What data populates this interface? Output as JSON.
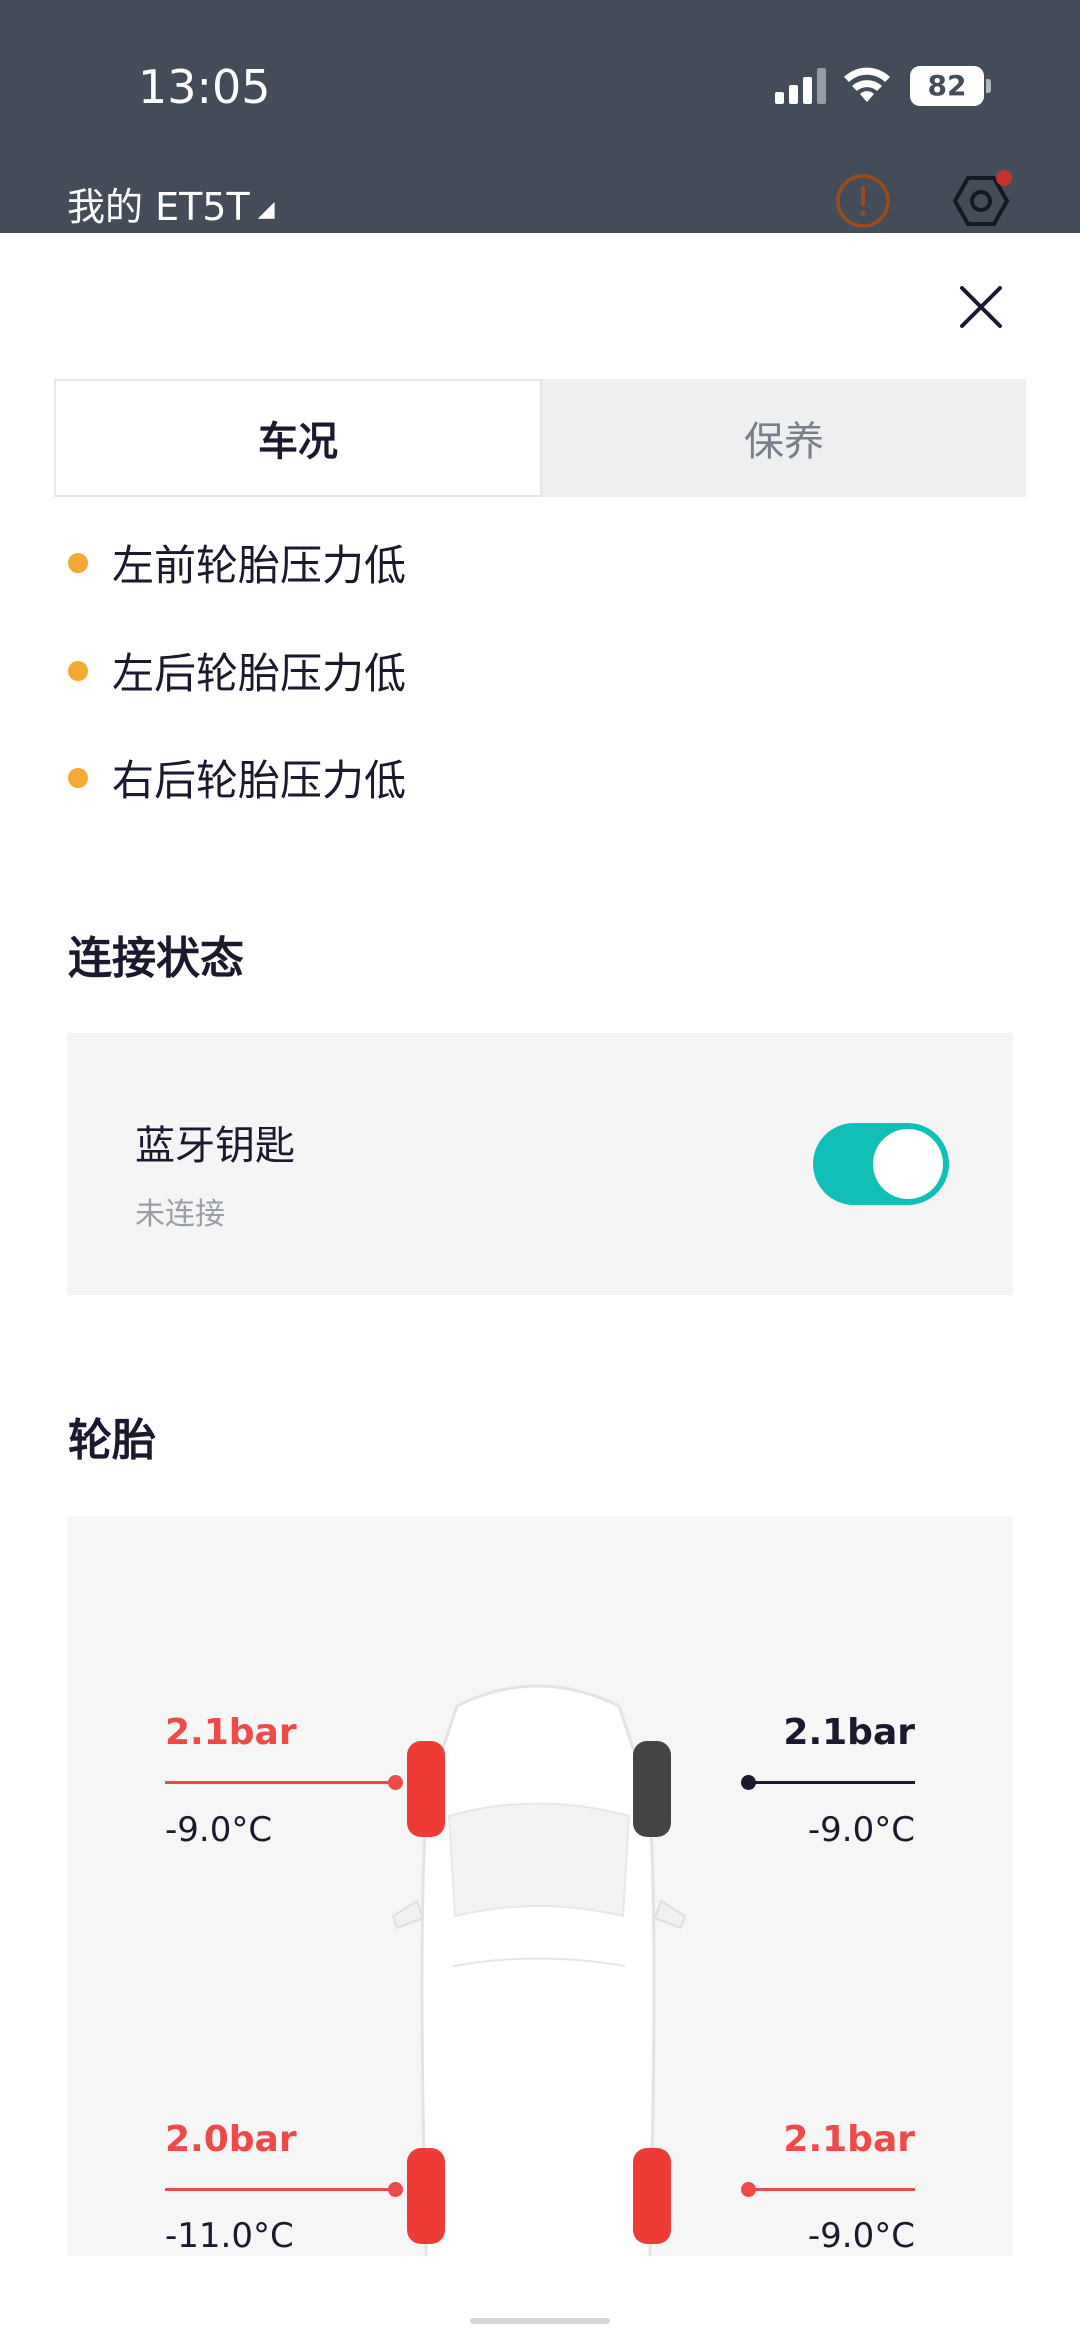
{
  "status_bar": {
    "time": "13:05",
    "battery": "82",
    "signal_icon": "cellular-signal-icon",
    "wifi_icon": "wifi-icon"
  },
  "header": {
    "car_name": "我的 ET5T",
    "dropdown_icon": "triangle-down-icon",
    "alert_icon": "alert-circle-icon",
    "settings_icon": "hexagon-settings-icon"
  },
  "sheet": {
    "close_icon": "close-icon"
  },
  "tabs": [
    {
      "label": "车况",
      "active": true
    },
    {
      "label": "保养",
      "active": false
    }
  ],
  "warnings": [
    {
      "text": "左前轮胎压力低",
      "color": "#f4a935"
    },
    {
      "text": "左后轮胎压力低",
      "color": "#f4a935"
    },
    {
      "text": "右后轮胎压力低",
      "color": "#f4a935"
    }
  ],
  "connection": {
    "title": "连接状态",
    "item_label": "蓝牙钥匙",
    "item_status": "未连接",
    "toggle_on": true,
    "toggle_color": "#10bfb6"
  },
  "tires": {
    "title": "轮胎",
    "front_left": {
      "pressure": "2.1bar",
      "temp": "-9.0°C",
      "warning": true
    },
    "front_right": {
      "pressure": "2.1bar",
      "temp": "-9.0°C",
      "warning": false
    },
    "rear_left": {
      "pressure": "2.0bar",
      "temp": "-11.0°C",
      "warning": true
    },
    "rear_right": {
      "pressure": "2.1bar",
      "temp": "-9.0°C",
      "warning": true
    },
    "warning_color": "#ee4a4a",
    "normal_color": "#1a1a2e"
  }
}
